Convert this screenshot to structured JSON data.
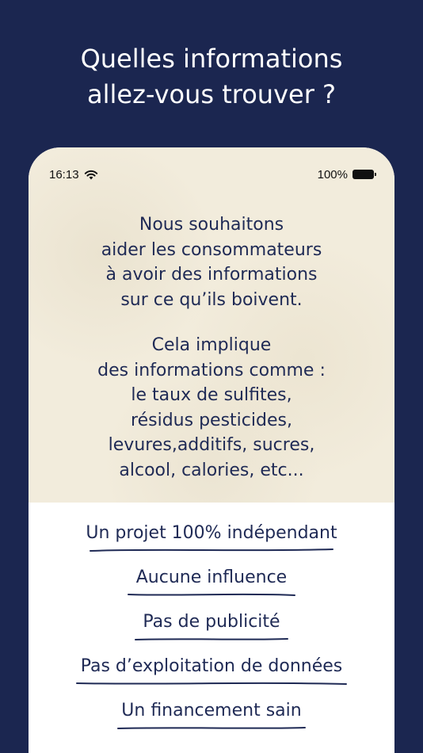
{
  "headline": {
    "line1": "Quelles informations",
    "line2": "allez-vous trouver ?"
  },
  "status_bar": {
    "time": "16:13",
    "battery": "100%",
    "icons": [
      "wifi-icon",
      "battery-icon"
    ]
  },
  "paragraph1": {
    "lines": [
      "Nous souhaitons",
      "aider les consommateurs",
      "à avoir des informations",
      "sur ce qu’ils boivent."
    ]
  },
  "paragraph2": {
    "lines": [
      "Cela implique",
      "des informations comme :",
      "le taux de sulfites,",
      "résidus pesticides,",
      "levures,additifs, sucres,",
      "alcool,  calories, etc..."
    ]
  },
  "claims": [
    "Un projet 100% indépendant",
    "Aucune influence",
    "Pas de publicité",
    "Pas d’exploitation de données",
    "Un financement sain"
  ],
  "colors": {
    "background": "#1b2650",
    "paper": "#f2ecdc",
    "ink": "#1f2a55"
  }
}
